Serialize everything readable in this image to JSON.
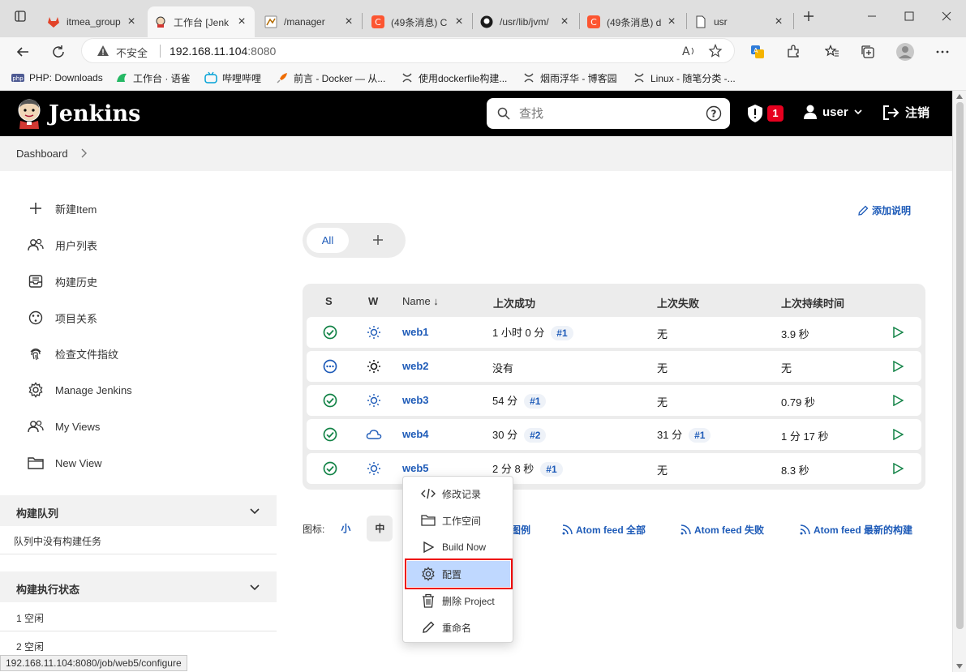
{
  "browser": {
    "tabs": [
      {
        "title": "itmea_group",
        "icon": "gitlab-icon",
        "color": "#e24329"
      },
      {
        "title": "工作台 [Jenk",
        "icon": "jenkins-icon",
        "color": "#d33833"
      },
      {
        "title": "/manager",
        "icon": "tomcat-icon",
        "color": "#888888"
      },
      {
        "title": "(49条消息) C",
        "icon": "csdn-icon",
        "color": "#fc5531"
      },
      {
        "title": "/usr/lib/jvm/",
        "icon": "github-icon",
        "color": "#1b1b1b"
      },
      {
        "title": "(49条消息) d",
        "icon": "csdn-icon",
        "color": "#fc5531"
      },
      {
        "title": "usr",
        "icon": "file-icon",
        "color": "#444444"
      }
    ],
    "active_tab": 1,
    "address": {
      "security": "不安全",
      "host": "192.168.11.104",
      "port": ":8080"
    },
    "bookmarks": [
      {
        "label": "PHP: Downloads",
        "icon": "php-icon",
        "color": "#4f5b93"
      },
      {
        "label": "工作台 · 语雀",
        "icon": "yuque-icon",
        "color": "#25b864"
      },
      {
        "label": "哔哩哔哩",
        "icon": "bilibili-icon",
        "color": "#00a1d6"
      },
      {
        "label": "前言 - Docker — 从...",
        "icon": "rocket-icon",
        "color": "#ef6c00"
      },
      {
        "label": "使用dockerfile构建...",
        "icon": "cnblogs-icon",
        "color": "#444444"
      },
      {
        "label": "烟雨浮华 - 博客园",
        "icon": "cnblogs-icon",
        "color": "#444444"
      },
      {
        "label": "Linux - 随笔分类 -...",
        "icon": "cnblogs-icon",
        "color": "#444444"
      }
    ],
    "status_url": "192.168.11.104:8080/job/web5/configure"
  },
  "jenkins": {
    "brand": "Jenkins",
    "search_placeholder": "查找",
    "security_count": "1",
    "user": "user",
    "logout": "注销",
    "breadcrumb": "Dashboard"
  },
  "sidebar": {
    "tasks": [
      {
        "label": "新建Item",
        "icon": "plus-icon"
      },
      {
        "label": "用户列表",
        "icon": "people-icon"
      },
      {
        "label": "构建历史",
        "icon": "inbox-icon"
      },
      {
        "label": "项目关系",
        "icon": "relationship-icon"
      },
      {
        "label": "检查文件指纹",
        "icon": "fingerprint-icon"
      },
      {
        "label": "Manage Jenkins",
        "icon": "gear-icon"
      },
      {
        "label": "My Views",
        "icon": "people-icon"
      },
      {
        "label": "New View",
        "icon": "folder-icon"
      }
    ],
    "queue": {
      "title": "构建队列",
      "empty": "队列中没有构建任务"
    },
    "executors": {
      "title": "构建执行状态",
      "items": [
        "1  空闲",
        "2  空闲"
      ]
    }
  },
  "main": {
    "add_description": "添加说明",
    "view_tabs": {
      "all": "All",
      "add": "+"
    },
    "columns": [
      "S",
      "W",
      "Name  ↓",
      "上次成功",
      "上次失败",
      "上次持续时间"
    ],
    "jobs": [
      {
        "name": "web1",
        "status": "success",
        "weather": "sunny",
        "last_success": "1 小时 0 分",
        "last_success_build": "#1",
        "last_failure": "无",
        "last_failure_build": "",
        "duration": "3.9 秒"
      },
      {
        "name": "web2",
        "status": "notbuilt",
        "weather": "sunny-dark",
        "last_success": "没有",
        "last_success_build": "",
        "last_failure": "无",
        "last_failure_build": "",
        "duration": "无"
      },
      {
        "name": "web3",
        "status": "success",
        "weather": "sunny",
        "last_success": "54 分",
        "last_success_build": "#1",
        "last_failure": "无",
        "last_failure_build": "",
        "duration": "0.79 秒"
      },
      {
        "name": "web4",
        "status": "success",
        "weather": "cloudy",
        "last_success": "30 分",
        "last_success_build": "#2",
        "last_failure": "31 分",
        "last_failure_build": "#1",
        "duration": "1 分 17 秒"
      },
      {
        "name": "web5",
        "status": "success",
        "weather": "sunny",
        "last_success": "2 分 8 秒",
        "last_success_build": "#1",
        "last_failure": "无",
        "last_failure_build": "",
        "duration": "8.3 秒"
      }
    ],
    "icon_size": {
      "label": "图标:",
      "small": "小",
      "medium": "中",
      "legend": "图例"
    },
    "feeds": [
      "Atom feed 全部",
      "Atom feed 失败",
      "Atom feed 最新的构建"
    ]
  },
  "context_menu": {
    "items": [
      {
        "label": "修改记录",
        "icon": "code-icon"
      },
      {
        "label": "工作空间",
        "icon": "folder-icon"
      },
      {
        "label": "Build Now",
        "icon": "play-icon"
      },
      {
        "label": "配置",
        "icon": "gear-icon"
      },
      {
        "label": "删除 Project",
        "icon": "trash-icon"
      },
      {
        "label": "重命名",
        "icon": "pencil-icon"
      }
    ],
    "highlighted": 3
  },
  "colors": {
    "success": "#138347",
    "notbuilt": "#1e5bb8",
    "weather": "#1e5bb8",
    "link": "#1e5bb8",
    "play": "#138347"
  }
}
